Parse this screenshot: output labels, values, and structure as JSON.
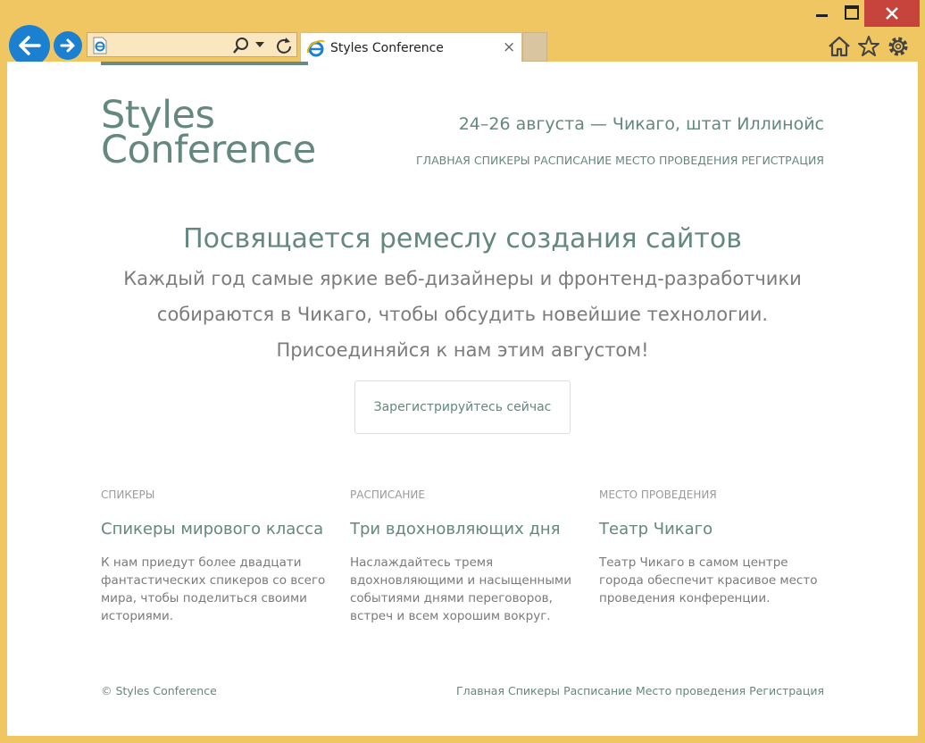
{
  "browser": {
    "tab_title": "Styles Conference",
    "close_tab_glyph": "×",
    "icons": [
      "back-arrow-icon",
      "forward-arrow-icon",
      "ie-page-icon",
      "search-icon",
      "dropdown-icon",
      "refresh-icon",
      "ie-logo-icon",
      "home-icon",
      "favorites-star-icon",
      "settings-gear-icon"
    ]
  },
  "site": {
    "logo_line1": "Styles",
    "logo_line2": "Conference",
    "dates": "24–26 августа — Чикаго, штат Иллинойс",
    "nav": [
      "ГЛАВНАЯ",
      "СПИКЕРЫ",
      "РАСПИСАНИЕ",
      "МЕСТО ПРОВЕДЕНИЯ",
      "РЕГИСТРАЦИЯ"
    ]
  },
  "hero": {
    "title": "Посвящается ремеслу создания сайтов",
    "line1": "Каждый год самые яркие веб-дизайнеры и фронтенд-разработчики",
    "line2": "собираются в Чикаго, чтобы обсудить новейшие технологии.",
    "line3": "Присоединяйся к нам этим августом!",
    "cta": "Зарегистрируйтесь сейчас"
  },
  "columns": [
    {
      "kicker": "СПИКЕРЫ",
      "title": "Спикеры мирового класса",
      "text": "К нам приедут более двадцати фантастических спикеров со всего мира, чтобы поделиться своими историями."
    },
    {
      "kicker": "РАСПИСАНИЕ",
      "title": "Три вдохновляющих дня",
      "text": "Наслаждайтесь тремя вдохновляющими и насыщенными событиями днями переговоров, встреч и всем хорошим вокруг."
    },
    {
      "kicker": "МЕСТО ПРОВЕДЕНИЯ",
      "title": "Театр Чикаго",
      "text": "Театр Чикаго в самом центре города обеспечит красивое место проведения конференции."
    }
  ],
  "footer": {
    "copyright": "© Styles Conference",
    "nav": [
      "Главная",
      "Спикеры",
      "Расписание",
      "Место проведения",
      "Регистрация"
    ]
  },
  "colors": {
    "accent": "#648780",
    "frame": "#f0c662",
    "text_muted": "#7c7c7c"
  }
}
